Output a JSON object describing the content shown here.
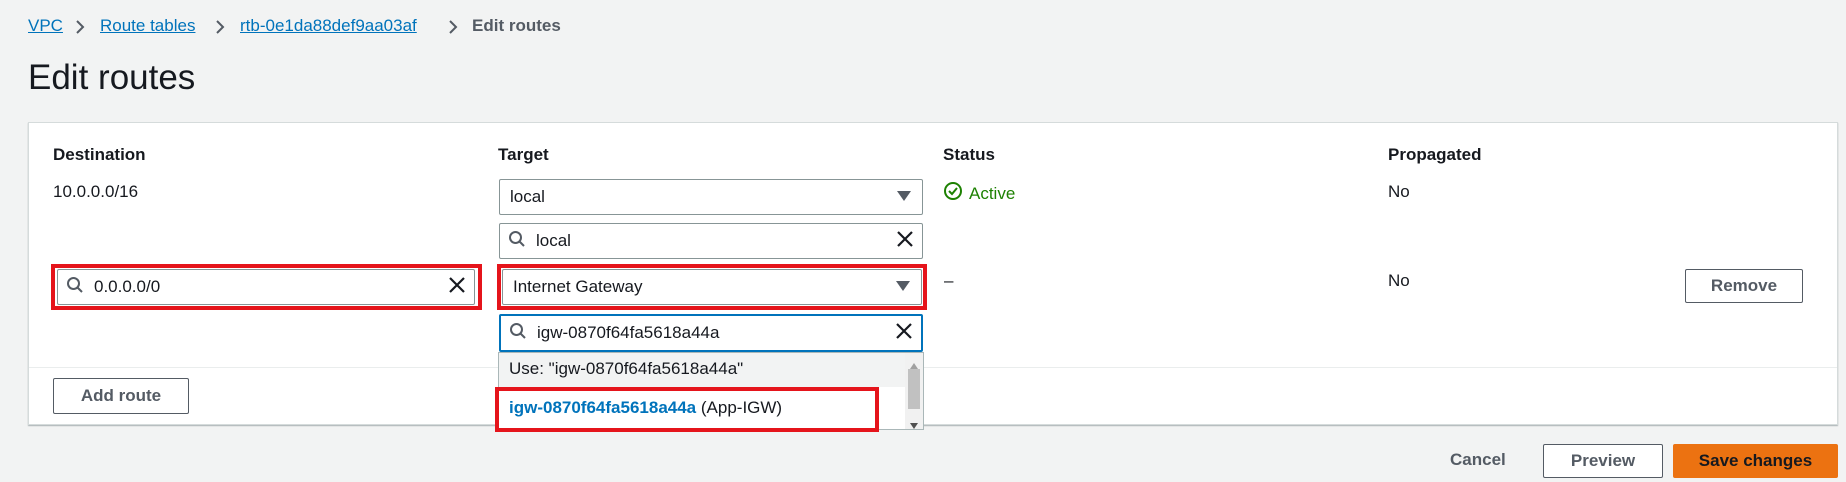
{
  "breadcrumb": {
    "items": [
      "VPC",
      "Route tables",
      "rtb-0e1da88def9aa03af"
    ],
    "current": "Edit routes"
  },
  "page_title": "Edit routes",
  "columns": {
    "destination": "Destination",
    "target": "Target",
    "status": "Status",
    "propagated": "Propagated"
  },
  "routes": [
    {
      "destination": "10.0.0.0/16",
      "target_select": "local",
      "target_search": "local",
      "status": "Active",
      "propagated": "No"
    },
    {
      "destination_value": "0.0.0.0/0",
      "target_select": "Internet Gateway",
      "target_search": "igw-0870f64fa5618a44a",
      "status": "–",
      "propagated": "No",
      "remove_label": "Remove"
    }
  ],
  "dropdown": {
    "use_option": "Use: \"igw-0870f64fa5618a44a\"",
    "option_id": "igw-0870f64fa5618a44a",
    "option_name": "(App-IGW)"
  },
  "buttons": {
    "add_route": "Add route",
    "cancel": "Cancel",
    "preview": "Preview",
    "save": "Save changes"
  },
  "colors": {
    "link": "#0073bb",
    "primary": "#ec7211",
    "success": "#1d8102",
    "highlight": "#e5141b"
  },
  "icons": [
    "chevron-right-icon",
    "search-icon",
    "clear-icon",
    "caret-down-icon",
    "check-circle-icon",
    "scroll-up-icon",
    "scroll-down-icon"
  ]
}
